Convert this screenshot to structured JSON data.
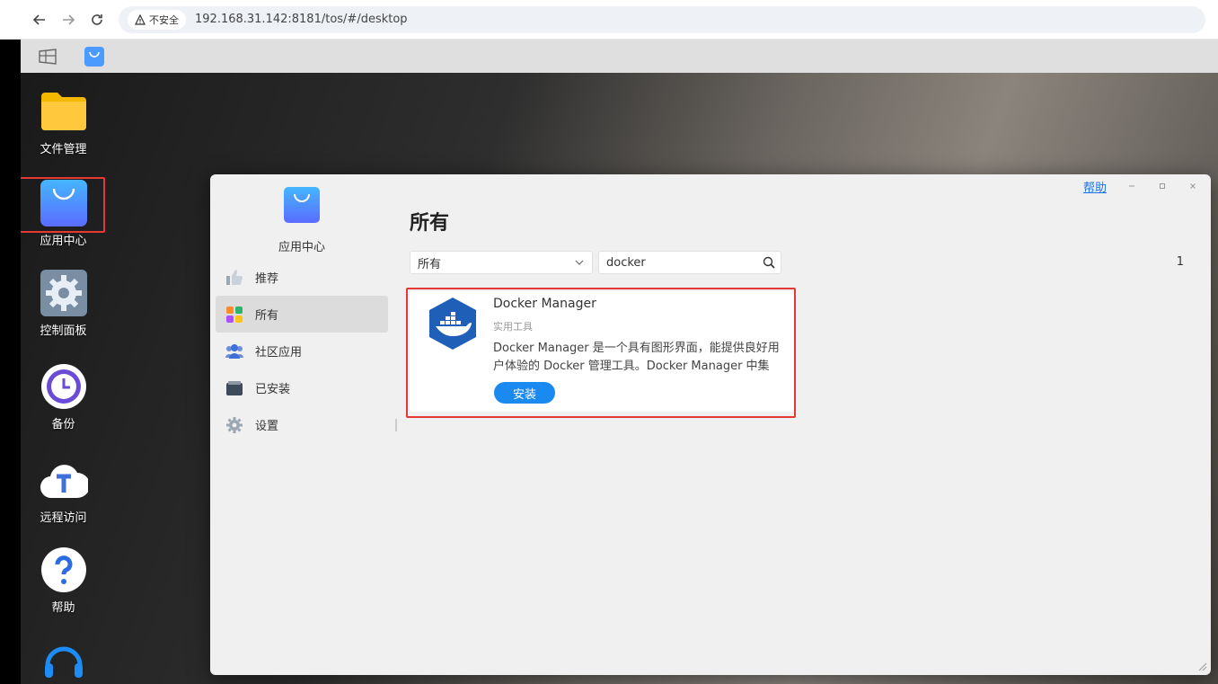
{
  "browser": {
    "security_label": "不安全",
    "url": "192.168.31.142:8181/tos/#/desktop"
  },
  "desktop": {
    "icons": [
      {
        "label": "文件管理",
        "icon": "folder-icon"
      },
      {
        "label": "应用中心",
        "icon": "shopping-bag-icon"
      },
      {
        "label": "控制面板",
        "icon": "gear-icon"
      },
      {
        "label": "备份",
        "icon": "clock-icon"
      },
      {
        "label": "远程访问",
        "icon": "cloud-t-icon"
      },
      {
        "label": "帮助",
        "icon": "question-icon"
      },
      {
        "label": "",
        "icon": "headset-icon"
      }
    ]
  },
  "window": {
    "help_label": "帮助",
    "app_name": "应用中心",
    "menu": [
      {
        "label": "推荐",
        "icon": "thumbs-up-icon"
      },
      {
        "label": "所有",
        "icon": "grid-icon",
        "active": true
      },
      {
        "label": "社区应用",
        "icon": "community-icon"
      },
      {
        "label": "已安装",
        "icon": "installed-icon"
      },
      {
        "label": "设置",
        "icon": "settings-icon"
      }
    ],
    "page_title": "所有",
    "filter": {
      "selected": "所有"
    },
    "search": {
      "value": "docker"
    },
    "result_count": "1",
    "app_card": {
      "title": "Docker Manager",
      "category": "实用工具",
      "description": "Docker Manager 是一个具有图形界面，能提供良好用户体验的 Docker 管理工具。Docker Manager 中集合...",
      "install_label": "安装"
    }
  },
  "colors": {
    "accent": "#1a8af0",
    "highlight": "#e53935",
    "link": "#1a73e8"
  }
}
